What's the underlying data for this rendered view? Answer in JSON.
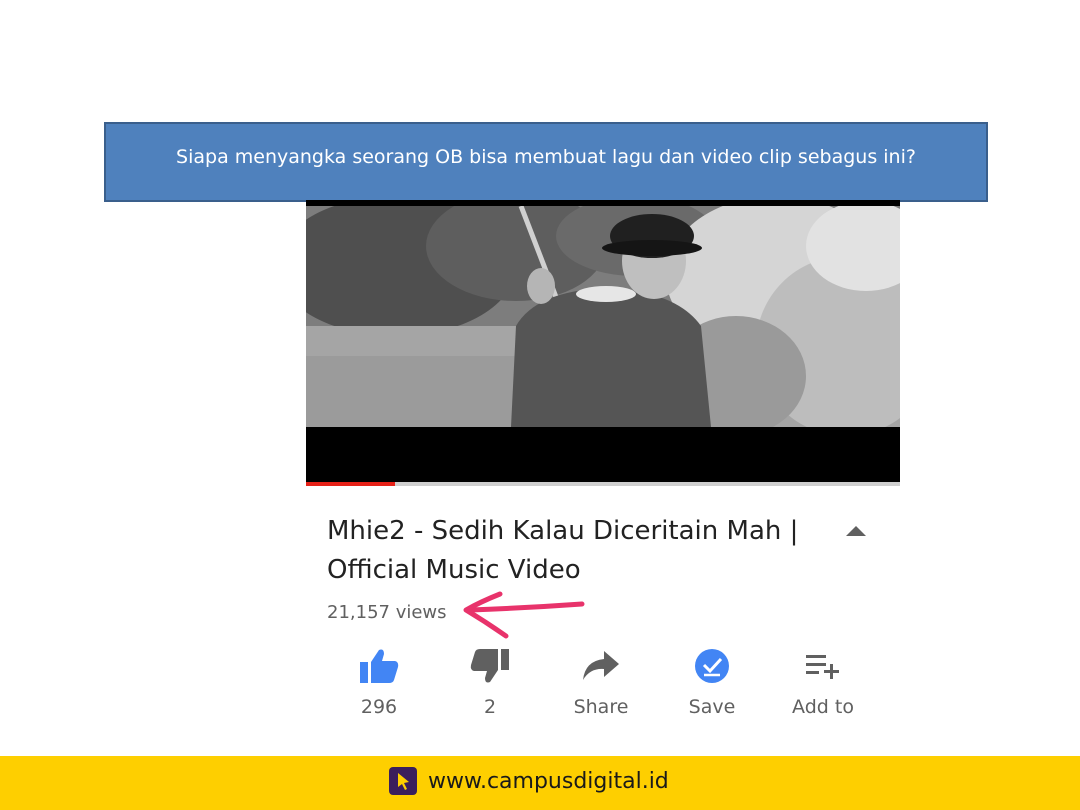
{
  "slide": {
    "banner_text": "Siapa menyangka seorang OB bisa membuat lagu dan video clip sebagus ini?",
    "footer_url": "www.campusdigital.id"
  },
  "colors": {
    "banner_bg": "#4f81bd",
    "footer_bg": "#fecf00",
    "progress_red": "#e62117",
    "like_blue": "#4285f4",
    "annotation_pink": "#e8336b"
  },
  "video": {
    "progress_fraction": 0.15,
    "title": "Mhie2 - Sedih Kalau Diceritain Mah | Official Music Video",
    "views": "21,157 views",
    "collapse_icon": "chevron-up-icon"
  },
  "actions": [
    {
      "icon": "thumbs-up-icon",
      "label": "296"
    },
    {
      "icon": "thumbs-down-icon",
      "label": "2"
    },
    {
      "icon": "share-icon",
      "label": "Share"
    },
    {
      "icon": "save-check-icon",
      "label": "Save"
    },
    {
      "icon": "playlist-add-icon",
      "label": "Add to"
    }
  ]
}
